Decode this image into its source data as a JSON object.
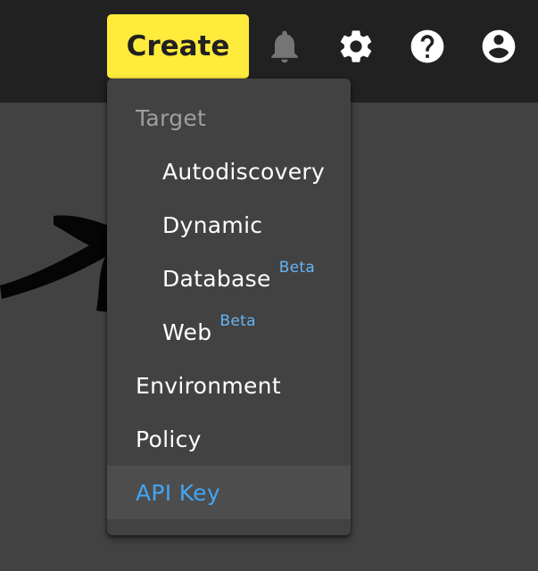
{
  "topbar": {
    "create_label": "Create",
    "icons": [
      "bell-icon",
      "gear-icon",
      "help-icon",
      "account-icon"
    ]
  },
  "menu": {
    "section_header": "Target",
    "items": [
      {
        "label": "Autodiscovery",
        "badge": ""
      },
      {
        "label": "Dynamic",
        "badge": ""
      },
      {
        "label": "Database",
        "badge": "Beta"
      },
      {
        "label": "Web",
        "badge": "Beta"
      },
      {
        "label": "Environment",
        "badge": ""
      },
      {
        "label": "Policy",
        "badge": ""
      },
      {
        "label": "API Key",
        "badge": ""
      }
    ]
  },
  "colors": {
    "topbar": "#212121",
    "background": "#424242",
    "create_button": "#ffeb3b",
    "accent": "#42a5f5",
    "beta": "#64b5f6",
    "muted_text": "#9e9e9e"
  }
}
